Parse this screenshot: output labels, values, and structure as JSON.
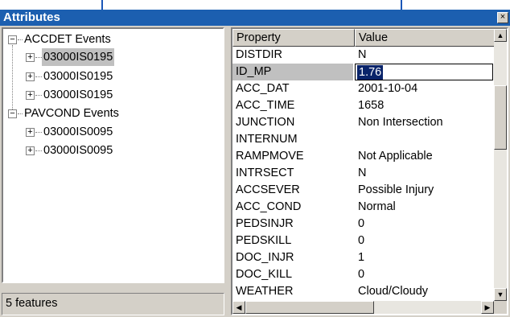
{
  "window": {
    "title": "Attributes",
    "close_glyph": "×"
  },
  "tree": {
    "groups": [
      {
        "label": "ACCDET Events",
        "toggle": "−",
        "children": [
          {
            "label": "03000IS0195",
            "toggle": "+",
            "selected": true
          },
          {
            "label": "03000IS0195",
            "toggle": "+"
          },
          {
            "label": "03000IS0195",
            "toggle": "+"
          }
        ]
      },
      {
        "label": "PAVCOND Events",
        "toggle": "−",
        "children": [
          {
            "label": "03000IS0095",
            "toggle": "+"
          },
          {
            "label": "03000IS0095",
            "toggle": "+"
          }
        ]
      }
    ]
  },
  "status": {
    "text": "5 features"
  },
  "grid": {
    "headers": {
      "property": "Property",
      "value": "Value"
    },
    "edit_value": "1.76",
    "rows": [
      {
        "property": "DISTDIR",
        "value": "N"
      },
      {
        "property": "ID_MP",
        "value": "1.76",
        "selected": true
      },
      {
        "property": "ACC_DAT",
        "value": "2001-10-04"
      },
      {
        "property": "ACC_TIME",
        "value": "1658"
      },
      {
        "property": "JUNCTION",
        "value": "Non Intersection"
      },
      {
        "property": "INTERNUM",
        "value": ""
      },
      {
        "property": "RAMPMOVE",
        "value": "Not Applicable"
      },
      {
        "property": "INTRSECT",
        "value": "N"
      },
      {
        "property": "ACCSEVER",
        "value": "Possible Injury"
      },
      {
        "property": "ACC_COND",
        "value": "Normal"
      },
      {
        "property": "PEDSINJR",
        "value": "0"
      },
      {
        "property": "PEDSKILL",
        "value": "0"
      },
      {
        "property": "DOC_INJR",
        "value": "1"
      },
      {
        "property": "DOC_KILL",
        "value": "0"
      },
      {
        "property": "WEATHER",
        "value": "Cloud/Cloudy"
      }
    ]
  },
  "colors": {
    "titlebar": "#1c5fb0",
    "callout": "#1a56b8",
    "selection": "#0a246a"
  },
  "icons": {
    "expand": "plus-icon",
    "collapse": "minus-icon",
    "close": "close-icon",
    "scroll_up": "arrow-up-icon",
    "scroll_down": "arrow-down-icon",
    "scroll_left": "arrow-left-icon",
    "scroll_right": "arrow-right-icon"
  }
}
